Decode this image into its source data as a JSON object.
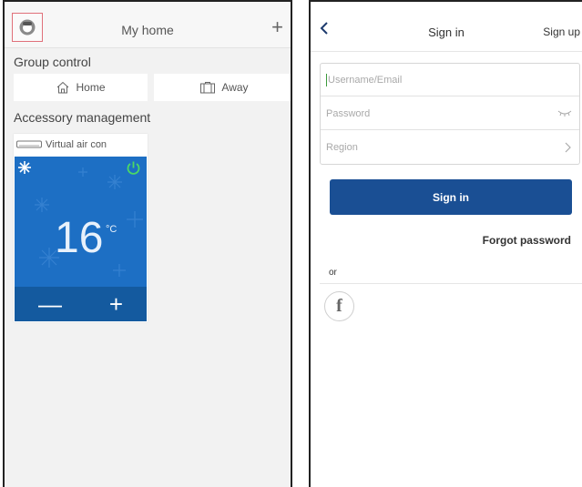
{
  "left": {
    "header": {
      "title": "My home",
      "add_symbol": "+"
    },
    "group_control": {
      "label": "Group control",
      "home": "Home",
      "away": "Away"
    },
    "accessory": {
      "label": "Accessory management",
      "device_name": "Virtual air con",
      "temperature": "16",
      "unit": "°C",
      "minus": "—",
      "plus": "+",
      "mode_icon": "snowflake-icon",
      "power_icon": "power-icon",
      "colors": {
        "panel": "#1d6fc4",
        "panel_bottom": "#145a9f",
        "power": "#4cd964"
      }
    }
  },
  "right": {
    "header": {
      "back": "‹",
      "title": "Sign in",
      "signup": "Sign up"
    },
    "form": {
      "username_placeholder": "Username/Email",
      "password_placeholder": "Password",
      "region_placeholder": "Region"
    },
    "signin_label": "Sign in",
    "forgot_label": "Forgot password",
    "or_label": "or",
    "facebook": "f",
    "colors": {
      "accent": "#1a4f94"
    }
  }
}
